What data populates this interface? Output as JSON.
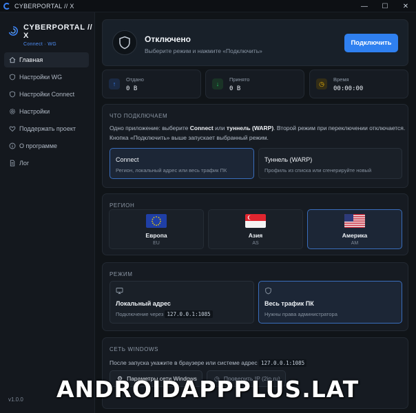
{
  "window": {
    "title": "CYBERPORTAL // X",
    "controls": {
      "minimize": "—",
      "maximize": "☐",
      "close": "✕"
    }
  },
  "sidebar": {
    "brand_title": "CYBERPORTAL // X",
    "brand_sub": "Connect · WG",
    "items": [
      {
        "label": "Главная",
        "icon": "home-icon",
        "active": true
      },
      {
        "label": "Настройки WG",
        "icon": "shield-icon",
        "active": false
      },
      {
        "label": "Настройки Connect",
        "icon": "shield-icon",
        "active": false
      },
      {
        "label": "Настройки",
        "icon": "gear-icon",
        "active": false
      },
      {
        "label": "Поддержать проект",
        "icon": "heart-icon",
        "active": false
      },
      {
        "label": "О программе",
        "icon": "info-icon",
        "active": false
      },
      {
        "label": "Лог",
        "icon": "document-icon",
        "active": false
      }
    ],
    "version": "v1.0.0"
  },
  "status": {
    "title": "Отключено",
    "subtitle": "Выберите режим и нажмите «Подключить»",
    "connect_label": "Подключить"
  },
  "stats": [
    {
      "label": "Отдано",
      "value": "0 B",
      "icon": "arrow-up-icon",
      "color": "#3b82f6"
    },
    {
      "label": "Принято",
      "value": "0 B",
      "icon": "arrow-down-icon",
      "color": "#22c55e"
    },
    {
      "label": "Время",
      "value": "00:00:00",
      "icon": "clock-icon",
      "color": "#eab308"
    }
  ],
  "what": {
    "title": "ЧТО ПОДКЛЮЧАЕМ",
    "desc_1a": "Одно приложение: выберите ",
    "desc_1b": "Connect",
    "desc_1c": " или ",
    "desc_1d": "туннель (WARP)",
    "desc_1e": ". Второй режим при переключении отключается.",
    "desc_2": "Кнопка «Подключить» выше запускает выбранный режим.",
    "options": [
      {
        "title": "Connect",
        "sub": "Регион, локальный адрес или весь трафик ПК",
        "selected": true
      },
      {
        "title": "Туннель (WARP)",
        "sub": "Профиль из списка или сгенерируйте новый",
        "selected": false
      }
    ]
  },
  "region": {
    "title": "РЕГИОН",
    "items": [
      {
        "name": "Европа",
        "code": "EU",
        "flag": "eu-flag-icon",
        "selected": false
      },
      {
        "name": "Азия",
        "code": "AS",
        "flag": "singapore-flag-icon",
        "selected": false
      },
      {
        "name": "Америка",
        "code": "AM",
        "flag": "usa-flag-icon",
        "selected": true
      }
    ]
  },
  "mode": {
    "title": "РЕЖИМ",
    "local": {
      "title": "Локальный адрес",
      "sub_prefix": "Подключение через",
      "address": "127.0.0.1:1085",
      "selected": false
    },
    "all": {
      "title": "Весь трафик ПК",
      "sub": "Нужны права администратора",
      "selected": true
    }
  },
  "network": {
    "title": "СЕТЬ WINDOWS",
    "desc_prefix": "После запуска укажите в браузере или системе адрес",
    "address": "127.0.0.1:1085",
    "btn_params": "Параметры сети Windows",
    "btn_check": "Проверить IP (2ip.ru)"
  },
  "watermark": "ANDROIDAPPPLUS.LAT"
}
